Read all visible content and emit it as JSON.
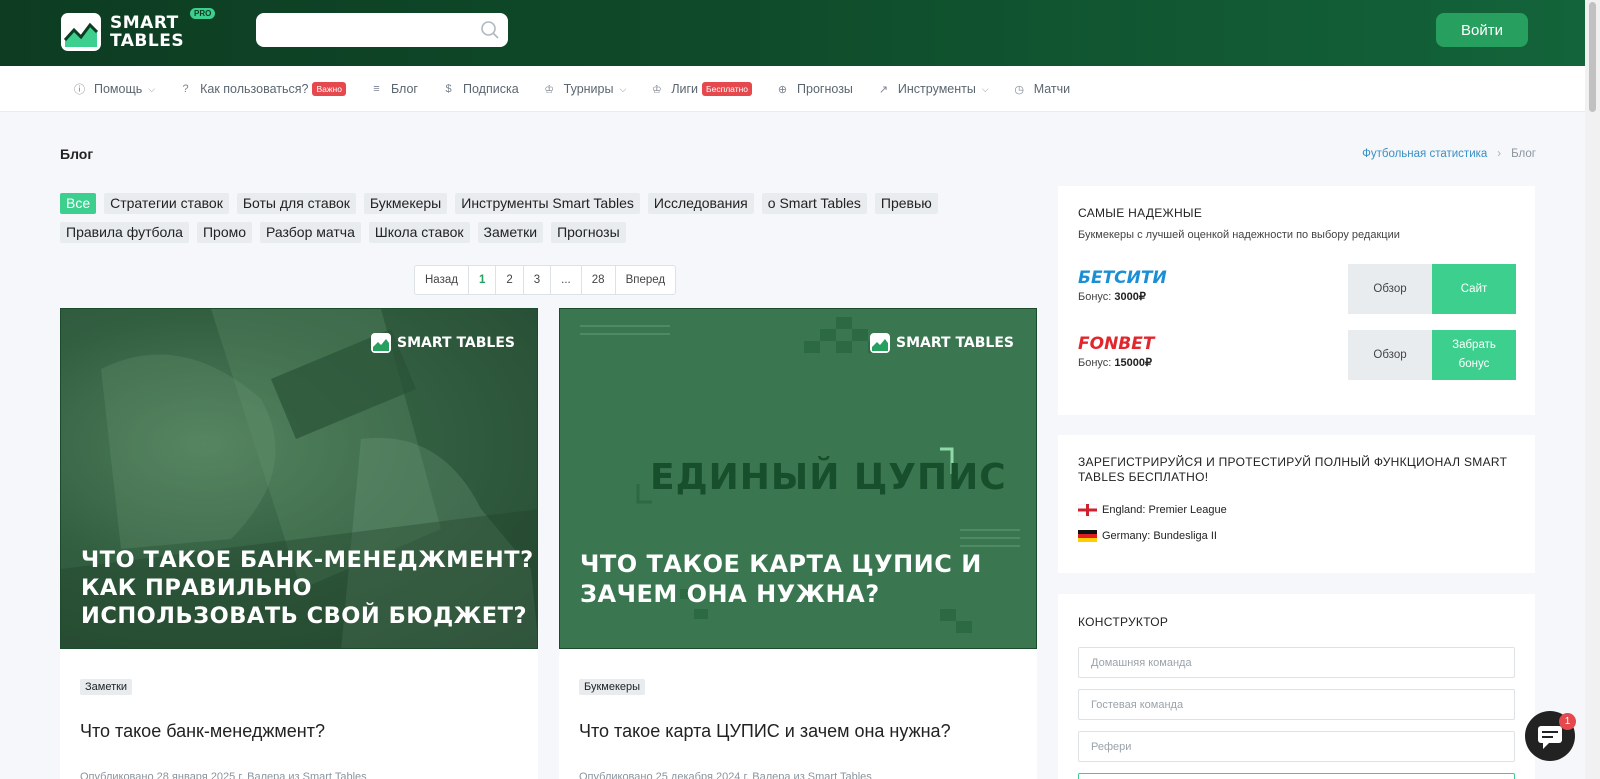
{
  "header": {
    "logo_line1": "SMART",
    "logo_line2": "TABLES",
    "logo_badge": "PRO",
    "search_placeholder": "",
    "login_label": "Войти"
  },
  "nav": [
    {
      "label": "Помощь",
      "icon": "info-icon",
      "has_dropdown": true,
      "badge": ""
    },
    {
      "label": "Как пользоваться?",
      "icon": "question-icon",
      "has_dropdown": false,
      "badge": "Важно"
    },
    {
      "label": "Блог",
      "icon": "list-icon",
      "has_dropdown": false,
      "badge": ""
    },
    {
      "label": "Подписка",
      "icon": "dollar-icon",
      "has_dropdown": false,
      "badge": ""
    },
    {
      "label": "Турниры",
      "icon": "trophy-icon",
      "has_dropdown": true,
      "badge": ""
    },
    {
      "label": "Лиги",
      "icon": "trophy-icon",
      "has_dropdown": false,
      "badge": "Бесплатно"
    },
    {
      "label": "Прогнозы",
      "icon": "globe-icon",
      "has_dropdown": false,
      "badge": ""
    },
    {
      "label": "Инструменты",
      "icon": "chart-icon",
      "has_dropdown": true,
      "badge": ""
    },
    {
      "label": "Матчи",
      "icon": "clock-icon",
      "has_dropdown": false,
      "badge": ""
    }
  ],
  "page": {
    "title": "Блог",
    "breadcrumb": {
      "parent": "Футбольная статистика",
      "current": "Блог"
    }
  },
  "categories": [
    "Все",
    "Стратегии ставок",
    "Боты для ставок",
    "Букмекеры",
    "Инструменты Smart Tables",
    "Исследования",
    "о Smart Tables",
    "Превью",
    "Правила футбола",
    "Промо",
    "Разбор матча",
    "Школа ставок",
    "Заметки",
    "Прогнозы"
  ],
  "active_category": "Все",
  "pagination": {
    "prev": "Назад",
    "pages": [
      "1",
      "2",
      "3",
      "...",
      "28"
    ],
    "next": "Вперед",
    "current": "1"
  },
  "posts": [
    {
      "image_brand": "SMART TABLES",
      "image_title": "Что такое банк-менеджмент? Как правильно использовать свой бюджет?",
      "image_center_text": "",
      "tag": "Заметки",
      "title": "Что такое банк-менеджмент?",
      "meta": "Опубликовано 28 января 2025 г. Валера из Smart Tables"
    },
    {
      "image_brand": "SMART TABLES",
      "image_title": "Что такое карта ЦУПИС и зачем она нужна?",
      "image_center_text": "ЕДИНЫЙ ЦУПИС",
      "tag": "Букмекеры",
      "title": "Что такое карта ЦУПИС и зачем она нужна?",
      "meta": "Опубликовано 25 декабря 2024 г. Валера из Smart Tables"
    }
  ],
  "sidebar": {
    "reliable": {
      "title": "САМЫЕ НАДЕЖНЫЕ",
      "subtitle": "Букмекеры с лучшей оценкой надежности по выбору редакции",
      "bookmakers": [
        {
          "name": "БЕТСИТИ",
          "bonus_label": "Бонус:",
          "bonus": "3000₽",
          "review": "Обзор",
          "cta": "Сайт",
          "color": "#1a8fd6"
        },
        {
          "name": "FONBET",
          "bonus_label": "Бонус:",
          "bonus": "15000₽",
          "review": "Обзор",
          "cta": "Забрать бонус",
          "color": "#e1262d"
        }
      ]
    },
    "register": {
      "title": "ЗАРЕГИСТРИРУЙСЯ И ПРОТЕСТИРУЙ ПОЛНЫЙ ФУНКЦИОНАЛ SMART TABLES БЕСПЛАТНО!",
      "leagues": [
        {
          "name": "England: Premier League",
          "flag": "england-flag-icon"
        },
        {
          "name": "Germany: Bundesliga II",
          "flag": "germany-flag-icon"
        }
      ]
    },
    "constructor": {
      "title": "КОНСТРУКТОР",
      "fields": [
        {
          "placeholder": "Домашняя команда"
        },
        {
          "placeholder": "Гостевая команда"
        },
        {
          "placeholder": "Рефери"
        }
      ]
    }
  },
  "chat": {
    "badge": "1"
  },
  "colors": {
    "header_dark": "#0d3c22",
    "accent": "#3ccf8e",
    "login": "#27a05f",
    "badge_red": "#e5484d",
    "link_blue": "#3a8fc4"
  }
}
